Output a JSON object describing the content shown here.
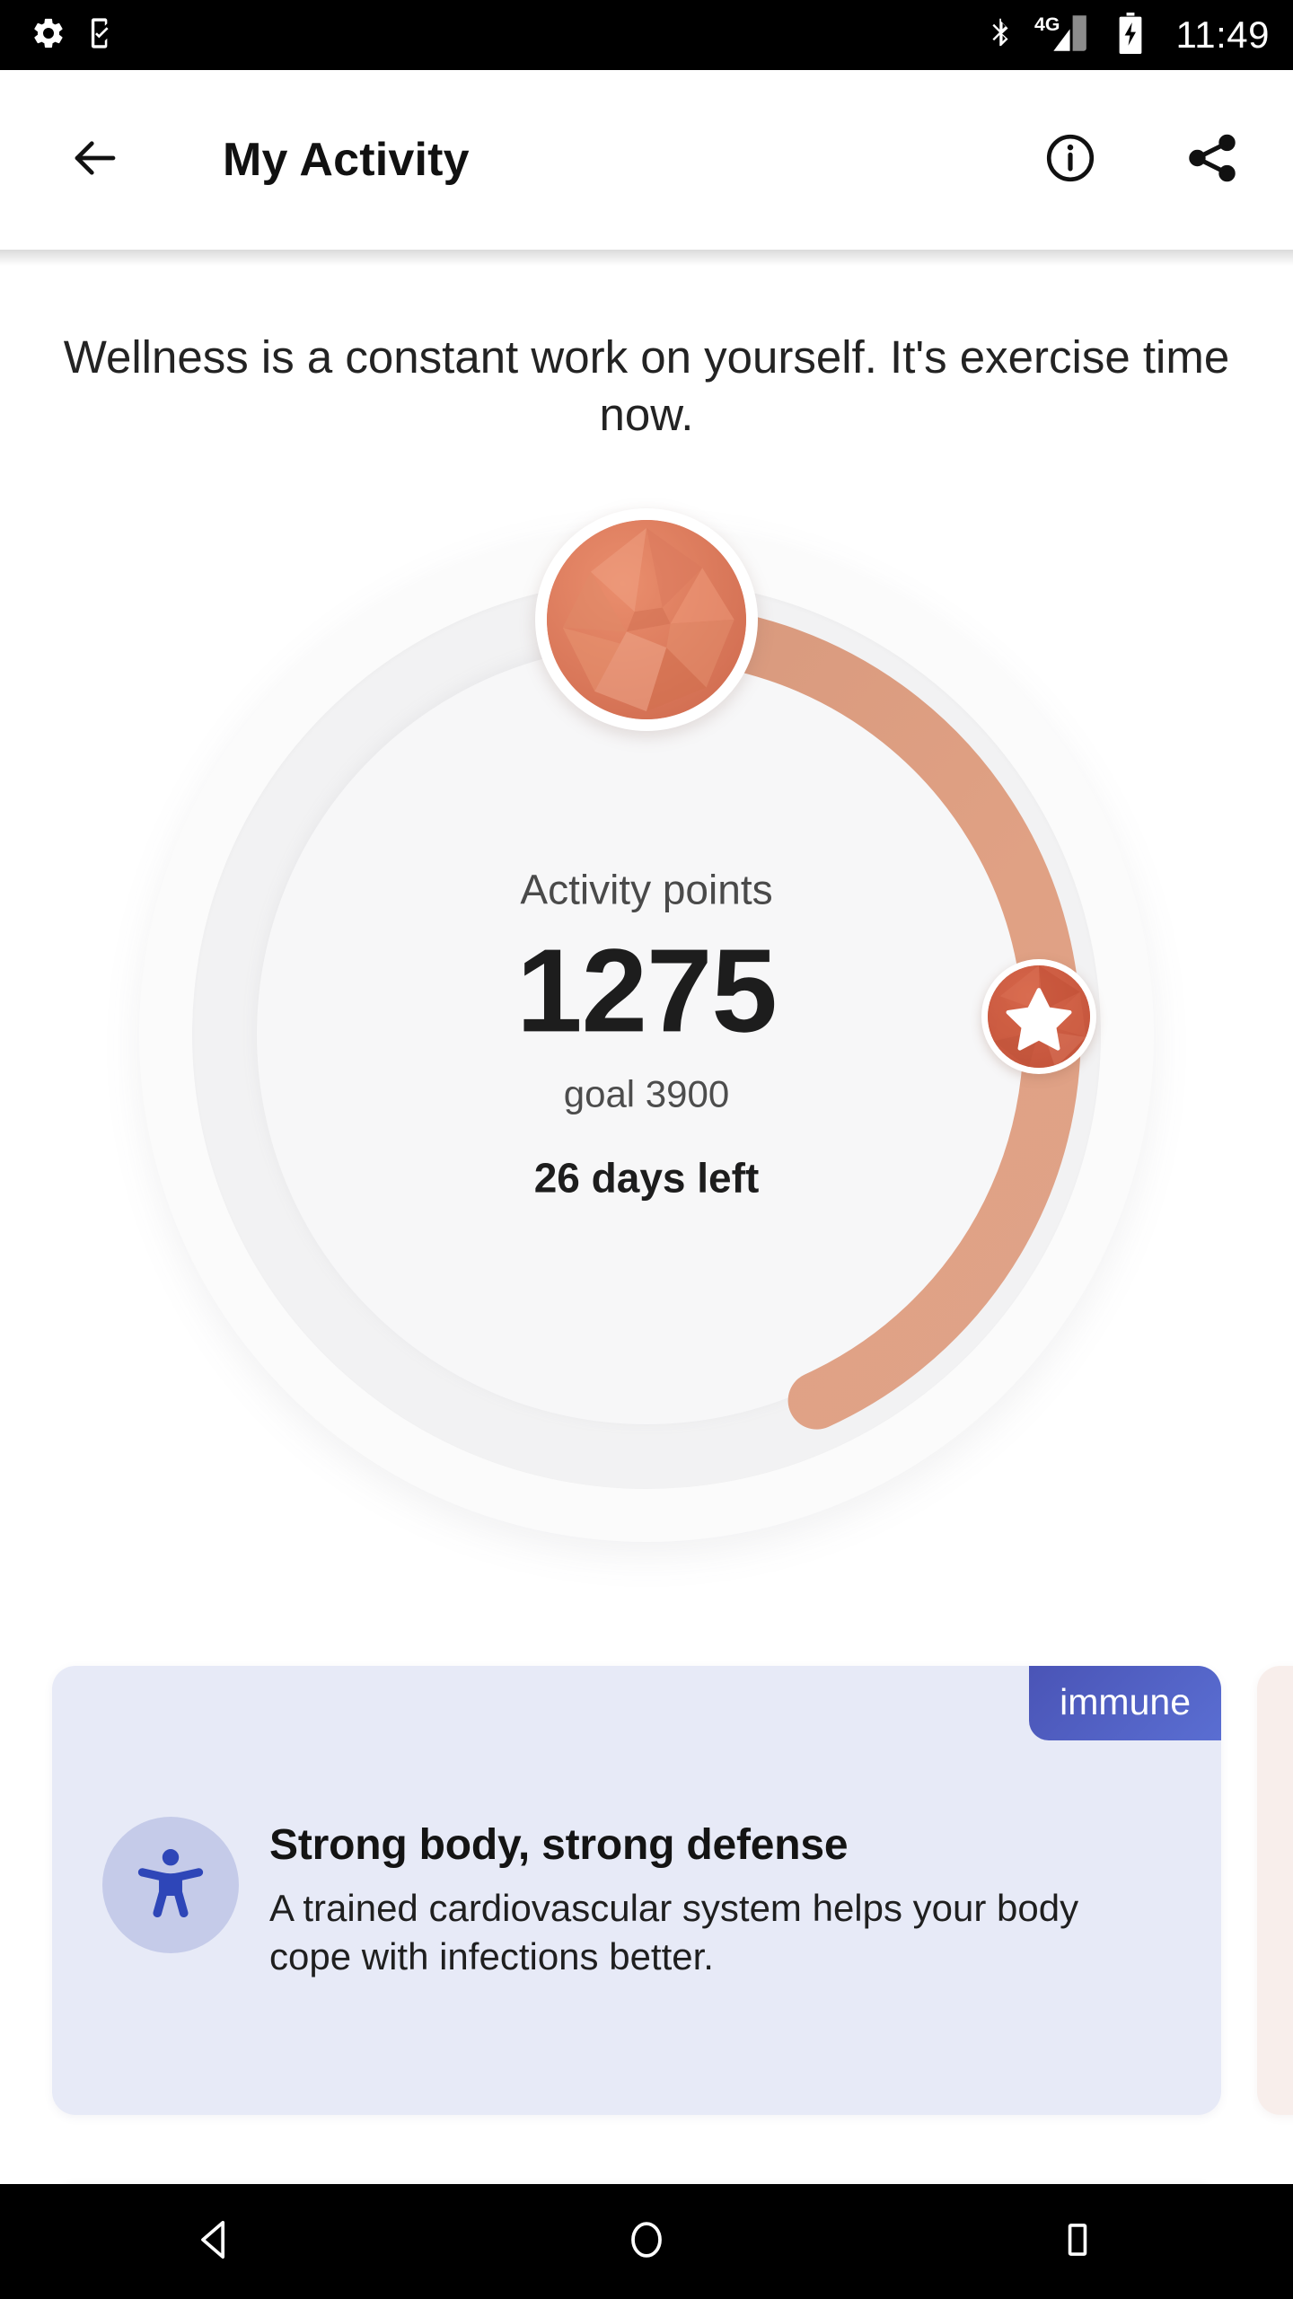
{
  "statusbar": {
    "time": "11:49",
    "icons_left": [
      "settings-gear-icon",
      "phone-checkmark-icon"
    ],
    "icons_right": [
      "bluetooth-icon",
      "signal-4g-icon",
      "battery-charging-icon"
    ],
    "network_label": "4G"
  },
  "appbar": {
    "back_icon": "back-arrow-icon",
    "title": "My Activity",
    "info_icon": "info-icon",
    "share_icon": "share-icon"
  },
  "headline": "Wellness is a constant work on yourself. It's exercise time now.",
  "progress": {
    "label": "Activity points",
    "value": "1275",
    "goal": "goal 3900",
    "days_left": "26 days left",
    "value_number": 1275,
    "goal_number": 3900,
    "percent": 32.7,
    "arc_color": "#e0a184",
    "track_color": "#f2f2f3",
    "avatar_icon": "gem-avatar-icon",
    "milestone_icon": "star-badge-icon",
    "milestone_color": "#cb5a3c"
  },
  "cards": [
    {
      "badge": "immune",
      "badge_color": "#4a54b6",
      "background": "#e7eaf7",
      "icon": "accessibility-icon",
      "icon_color": "#2e46b8",
      "title": "Strong body, strong defense",
      "description": "A trained cardiovascular system helps your body cope with infections better."
    },
    {
      "background": "#f8eeeb"
    }
  ],
  "navbar": {
    "back": "nav-back-icon",
    "home": "nav-home-icon",
    "recents": "nav-recents-icon"
  }
}
